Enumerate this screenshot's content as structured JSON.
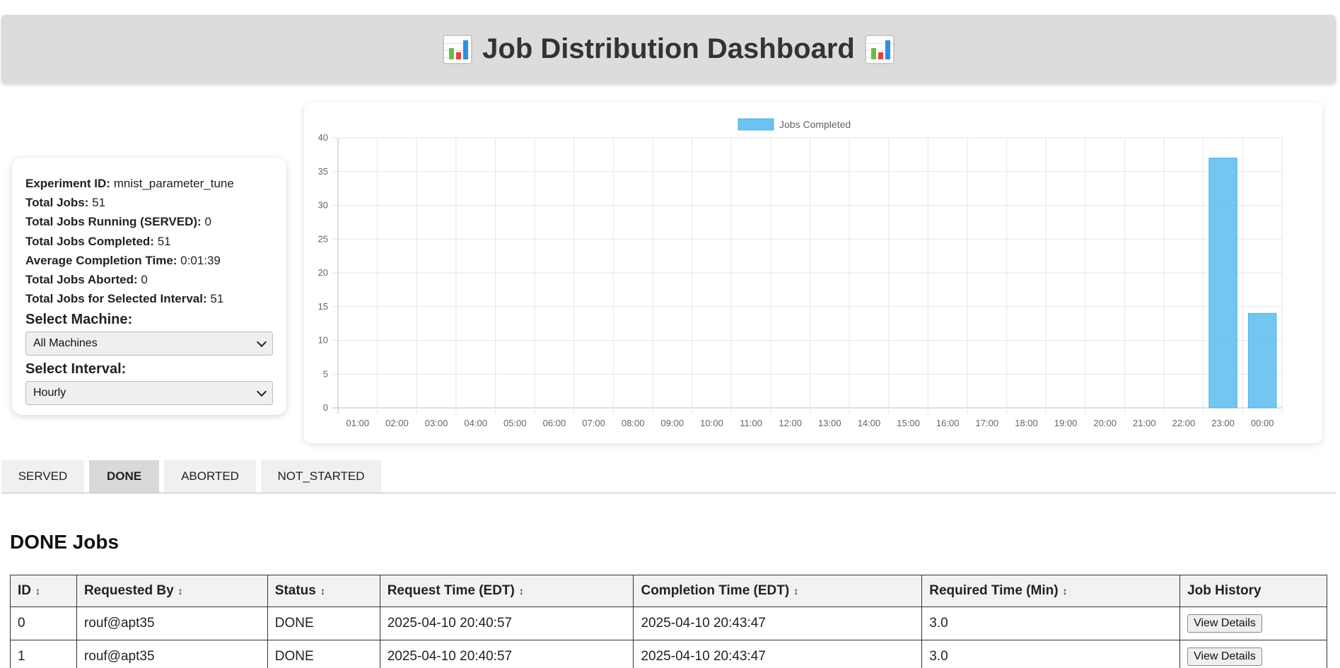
{
  "header": {
    "title": "Job Distribution Dashboard",
    "icon": "bar-chart-emoji"
  },
  "info": {
    "experiment_id_label": "Experiment ID:",
    "experiment_id": "mnist_parameter_tune",
    "total_jobs_label": "Total Jobs:",
    "total_jobs": "51",
    "running_label": "Total Jobs Running (SERVED):",
    "running": "0",
    "completed_label": "Total Jobs Completed:",
    "completed": "51",
    "avg_time_label": "Average Completion Time:",
    "avg_time": "0:01:39",
    "aborted_label": "Total Jobs Aborted:",
    "aborted": "0",
    "interval_total_label": "Total Jobs for Selected Interval:",
    "interval_total": "51",
    "machine_label": "Select Machine:",
    "machine_value": "All Machines",
    "interval_label": "Select Interval:",
    "interval_value": "Hourly"
  },
  "chart_data": {
    "type": "bar",
    "title": "",
    "xlabel": "",
    "ylabel": "",
    "ylim": [
      0,
      40
    ],
    "yticks": [
      0,
      5,
      10,
      15,
      20,
      25,
      30,
      35,
      40
    ],
    "grid": true,
    "legend_position": "top-center",
    "color": "#6cc3ef",
    "categories": [
      "01:00",
      "02:00",
      "03:00",
      "04:00",
      "05:00",
      "06:00",
      "07:00",
      "08:00",
      "09:00",
      "10:00",
      "11:00",
      "12:00",
      "13:00",
      "14:00",
      "15:00",
      "16:00",
      "17:00",
      "18:00",
      "19:00",
      "20:00",
      "21:00",
      "22:00",
      "23:00",
      "00:00"
    ],
    "series": [
      {
        "name": "Jobs Completed",
        "values": [
          0,
          0,
          0,
          0,
          0,
          0,
          0,
          0,
          0,
          0,
          0,
          0,
          0,
          0,
          0,
          0,
          0,
          0,
          0,
          0,
          0,
          0,
          37,
          14
        ]
      }
    ]
  },
  "tabs": [
    {
      "label": "SERVED",
      "active": false
    },
    {
      "label": "DONE",
      "active": true
    },
    {
      "label": "ABORTED",
      "active": false
    },
    {
      "label": "NOT_STARTED",
      "active": false
    }
  ],
  "section_title": "DONE Jobs",
  "table": {
    "columns": [
      "ID",
      "Requested By",
      "Status",
      "Request Time (EDT)",
      "Completion Time (EDT)",
      "Required Time (Min)",
      "Job History"
    ],
    "sort_glyph": "↕",
    "rows": [
      [
        "0",
        "rouf@apt35",
        "DONE",
        "2025-04-10 20:40:57",
        "2025-04-10 20:43:47",
        "3.0",
        "View Details"
      ],
      [
        "1",
        "rouf@apt35",
        "DONE",
        "2025-04-10 20:40:57",
        "2025-04-10 20:43:47",
        "3.0",
        "View Details"
      ]
    ]
  }
}
